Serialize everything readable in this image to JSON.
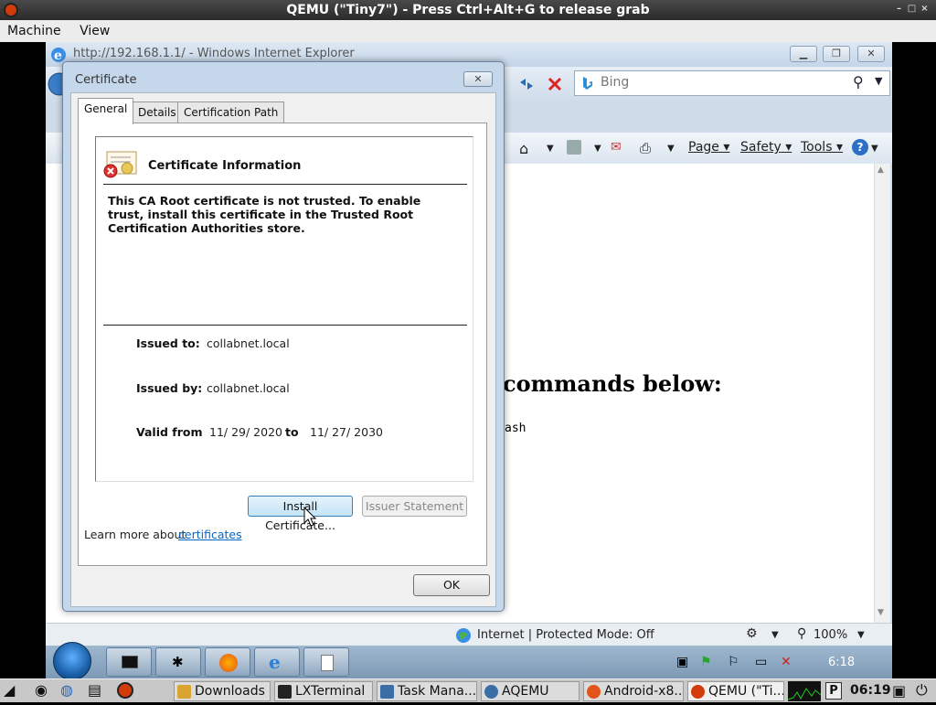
{
  "qemu": {
    "title": "QEMU (\"Tiny7\") - Press Ctrl+Alt+G to release grab",
    "menu": [
      "Machine",
      "View"
    ]
  },
  "ie": {
    "window_title": "http://192.168.1.1/ - Windows Internet Explorer",
    "search_placeholder": "Bing",
    "cmd": {
      "page": "Page",
      "safety": "Safety",
      "tools": "Tools"
    },
    "content": {
      "heading_fragment": "commands below:",
      "code_fragment": "ash"
    },
    "status": {
      "zone": "Internet | Protected Mode: Off",
      "zoom": "100%"
    }
  },
  "cert_dialog": {
    "title": "Certificate",
    "tabs": [
      "General",
      "Details",
      "Certification Path"
    ],
    "info_heading": "Certificate Information",
    "message": "This CA Root certificate is not trusted. To enable trust, install this certificate in the Trusted Root Certification Authorities store.",
    "issued_to_label": "Issued to:",
    "issued_to": "collabnet.local",
    "issued_by_label": "Issued by:",
    "issued_by": "collabnet.local",
    "valid_from_label": "Valid from",
    "valid_from": "11/ 29/ 2020",
    "to_label": "to",
    "valid_to": "11/ 27/ 2030",
    "install_button": "Install Certificate...",
    "issuer_button": "Issuer Statement",
    "learn_more": "Learn more about",
    "learn_more_link": "certificates",
    "ok_button": "OK"
  },
  "win_taskbar": {
    "clock": "6:18"
  },
  "host_taskbar": {
    "items": [
      "Downloads",
      "LXTerminal",
      "Task Mana...",
      "AQEMU",
      "Android-x8...",
      "QEMU (\"Ti..."
    ],
    "clock": "06:19"
  },
  "colors": {
    "accent": "#3c7fb1",
    "link": "#0066cc",
    "error": "#cc2222"
  }
}
